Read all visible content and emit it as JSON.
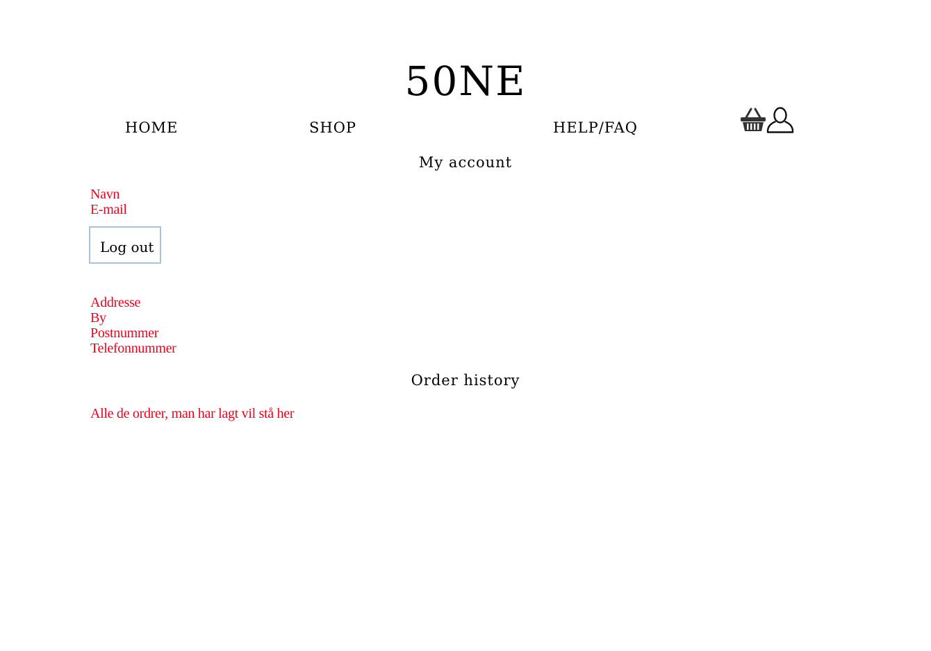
{
  "brand": {
    "logo": "50NE"
  },
  "nav": {
    "home": "HOME",
    "shop": "SHOP",
    "help": "HELP/FAQ",
    "basket_icon": "basket-icon",
    "user_icon": "user-icon"
  },
  "account": {
    "title": "My account",
    "name_label": "Navn",
    "email_label": "E-mail",
    "logout_label": "Log out",
    "address_label": "Addresse",
    "city_label": "By",
    "postcode_label": "Postnummer",
    "phone_label": "Telefonnummer"
  },
  "orders": {
    "title": "Order history",
    "placeholder": "Alle de ordrer, man har lagt vil stå her"
  },
  "colors": {
    "field_text": "#f0001a",
    "button_border": "#a9c2dd"
  }
}
